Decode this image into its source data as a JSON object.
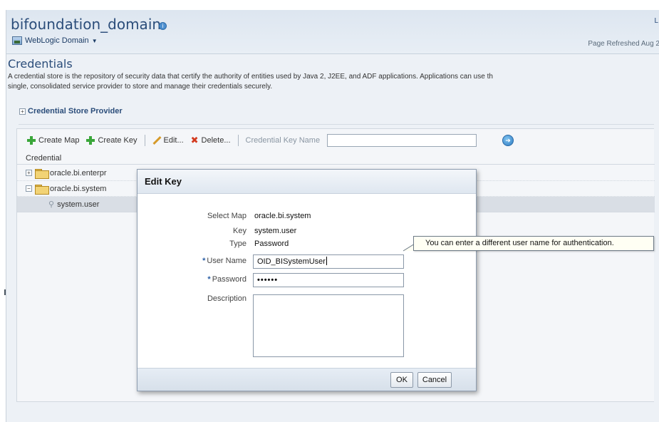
{
  "header": {
    "domain_title": "bifoundation_domain",
    "help_glyph": "i",
    "menu_label": "WebLogic Domain",
    "top_right_text": "L",
    "refreshed_text": "Page Refreshed Aug 2"
  },
  "page": {
    "section_title": "Credentials",
    "description": "A credential store is the repository of security data that certify the authority of entities used by Java 2, J2EE, and ADF applications. Applications can use th\nsingle, consolidated service provider to store and manage their credentials securely.",
    "provider_label": "Credential Store Provider"
  },
  "toolbar": {
    "create_map": "Create Map",
    "create_key": "Create Key",
    "edit": "Edit...",
    "delete": "Delete...",
    "key_name_label": "Credential Key Name",
    "key_name_value": ""
  },
  "table": {
    "column_credential": "Credential",
    "rows": [
      {
        "label": "oracle.bi.enterpr"
      },
      {
        "label": "oracle.bi.system"
      },
      {
        "label": "system.user"
      }
    ]
  },
  "dialog": {
    "title": "Edit Key",
    "select_map_label": "Select Map",
    "select_map_value": "oracle.bi.system",
    "key_label": "Key",
    "key_value": "system.user",
    "type_label": "Type",
    "type_value": "Password",
    "username_label": "User Name",
    "username_value": "OID_BISystemUser",
    "password_label": "Password",
    "password_value": "••••••",
    "description_label": "Description",
    "description_value": "",
    "required_marker": "*",
    "ok_label": "OK",
    "cancel_label": "Cancel"
  },
  "callout": {
    "text": "You can enter a different user name for authentication."
  },
  "icons": {
    "domain_help": "info-icon",
    "weblogic": "weblogic-domain-icon",
    "create": "plus-icon",
    "edit": "pencil-icon",
    "delete": "red-x-icon",
    "search_go": "go-icon",
    "folder": "folder-icon",
    "key": "key-icon"
  },
  "colors": {
    "accent": "#2b4d7a",
    "header_bg": "#dde6f0",
    "create_green": "#3aa63a",
    "delete_red": "#d33a1f"
  }
}
